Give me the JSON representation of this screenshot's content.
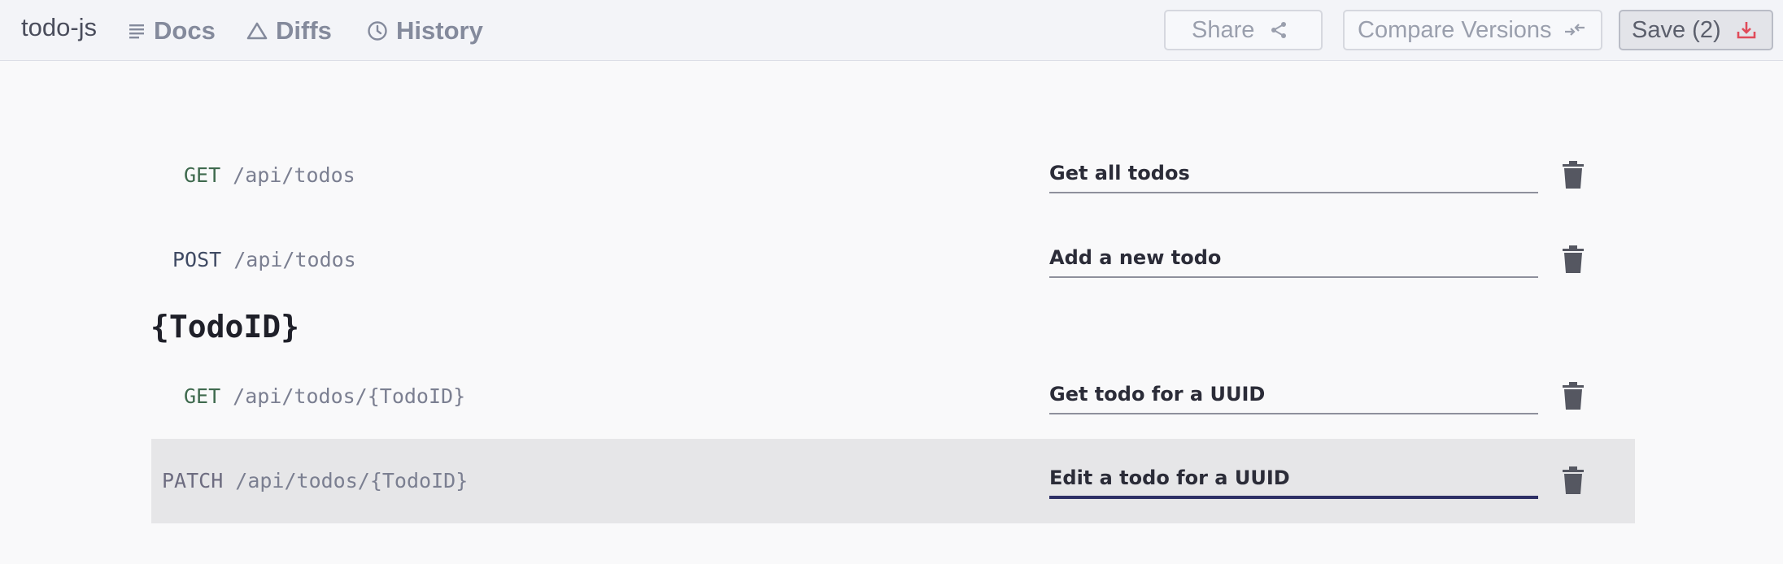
{
  "app": {
    "title": "todo-js"
  },
  "nav": {
    "docs": "Docs",
    "diffs": "Diffs",
    "history": "History"
  },
  "toolbar": {
    "share_label": "Share",
    "compare_label": "Compare Versions",
    "save_label": "Save (2)"
  },
  "icons": {
    "docs": "lines-icon",
    "diffs": "triangle-icon",
    "history": "clock-icon",
    "share": "share-icon",
    "compare": "compare-arrows-icon",
    "save": "download-icon",
    "delete": "trash-icon"
  },
  "colors": {
    "save_icon": "#e04b5a",
    "active_underline": "#2e3066",
    "get_method": "#3f6a4e"
  },
  "endpoints": {
    "group_heading": "{TodoID}",
    "rows": [
      {
        "method": "GET",
        "path": "/api/todos",
        "description": "Get all todos"
      },
      {
        "method": "POST",
        "path": "/api/todos",
        "description": "Add a new todo"
      },
      {
        "method": "GET",
        "path": "/api/todos/{TodoID}",
        "description": "Get todo for a UUID"
      },
      {
        "method": "PATCH",
        "path": "/api/todos/{TodoID}",
        "description": "Edit a todo for a UUID"
      }
    ]
  }
}
